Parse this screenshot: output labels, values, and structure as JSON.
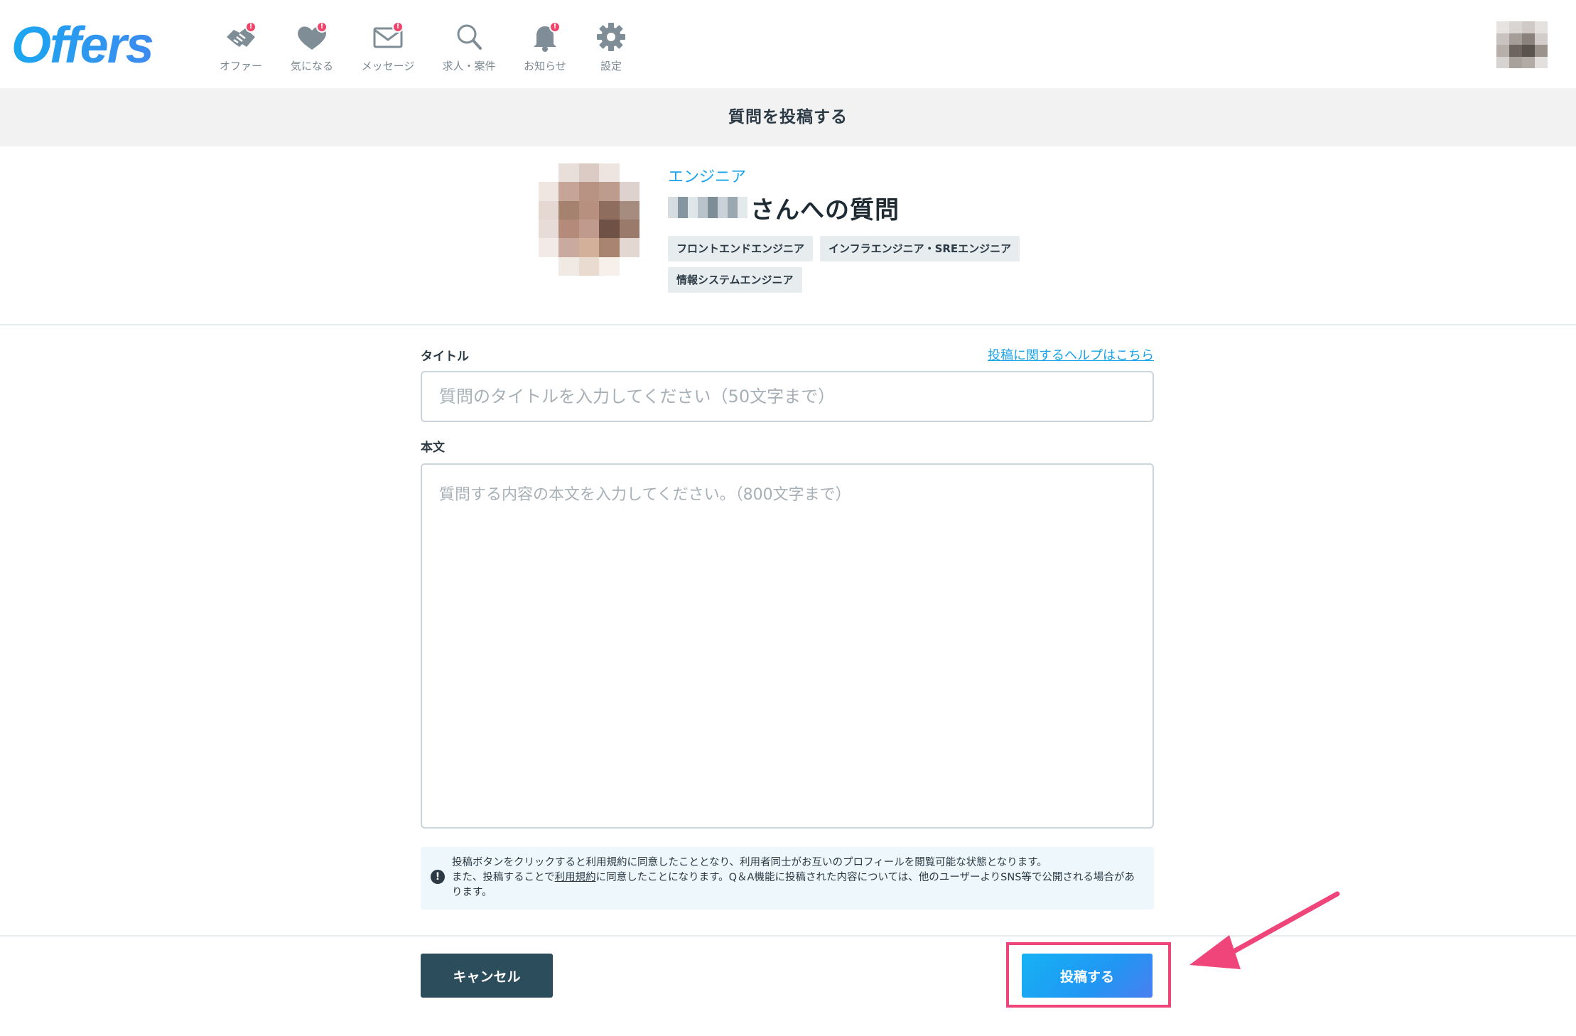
{
  "brand": {
    "logo_text": "Offers",
    "accent_color": "#1aa7f0",
    "badge_color": "#f0456b"
  },
  "nav": [
    {
      "label": "オファー",
      "icon": "handshake-icon",
      "badge": "!"
    },
    {
      "label": "気になる",
      "icon": "heart-icon",
      "badge": "!"
    },
    {
      "label": "メッセージ",
      "icon": "envelope-icon",
      "badge": "!"
    },
    {
      "label": "求人・案件",
      "icon": "search-icon",
      "badge": ""
    },
    {
      "label": "お知らせ",
      "icon": "bell-icon",
      "badge": "!"
    },
    {
      "label": "設定",
      "icon": "gear-icon",
      "badge": ""
    }
  ],
  "page": {
    "title": "質問を投稿する"
  },
  "target": {
    "role": "エンジニア",
    "name_suffix": "さんへの質問",
    "tags": [
      "フロントエンドエンジニア",
      "インフラエンジニア・SREエンジニア",
      "情報システムエンジニア"
    ]
  },
  "form": {
    "title_label": "タイトル",
    "help_link": "投稿に関するヘルプはこちら",
    "title_placeholder": "質問のタイトルを入力してください（50文字まで）",
    "body_label": "本文",
    "body_placeholder": "質問する内容の本文を入力してください。（800文字まで）"
  },
  "notice": {
    "line1": "投稿ボタンをクリックすると利用規約に同意したこととなり、利用者同士がお互いのプロフィールを閲覧可能な状態となります。",
    "line2_prefix": "また、投稿することで",
    "line2_link": "利用規約",
    "line2_suffix": "に同意したことになります。Q＆A機能に投稿された内容については、他のユーザーよりSNS等で公開される場合があります。"
  },
  "actions": {
    "cancel_label": "キャンセル",
    "submit_label": "投稿する"
  }
}
